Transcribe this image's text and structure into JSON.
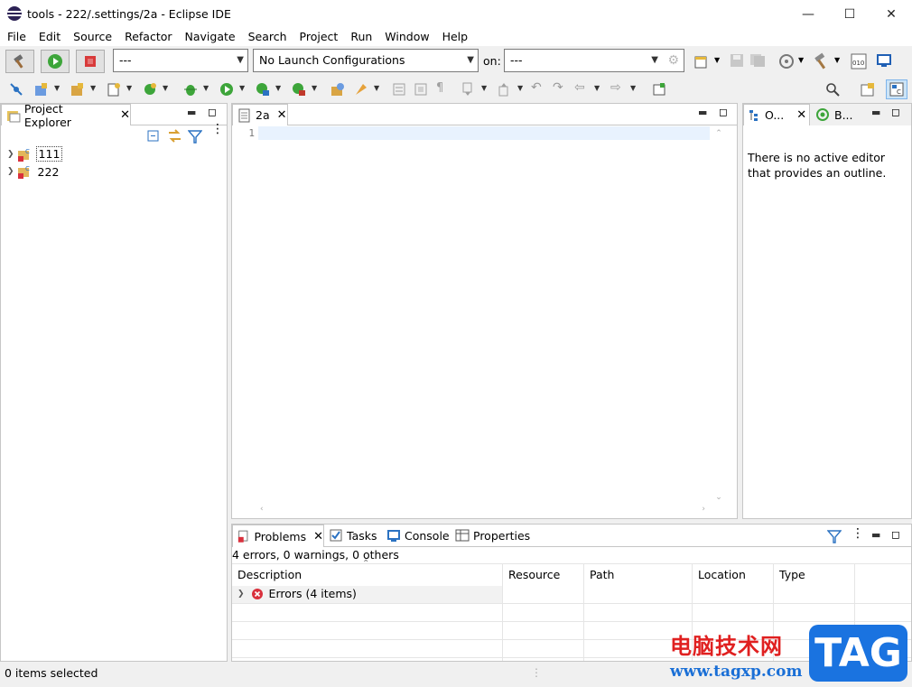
{
  "window": {
    "title": "tools - 222/.settings/2a - Eclipse IDE"
  },
  "menu": [
    "File",
    "Edit",
    "Source",
    "Refactor",
    "Navigate",
    "Search",
    "Project",
    "Run",
    "Window",
    "Help"
  ],
  "toolbar": {
    "run_combo_value": "---",
    "launch_config_value": "No Launch Configurations",
    "on_label": "on:",
    "target_combo_value": "---"
  },
  "project_explorer": {
    "tab_label": "Project Explorer",
    "projects": [
      "111",
      "222"
    ]
  },
  "editor": {
    "tab_label": "2a",
    "line_numbers": [
      "1"
    ]
  },
  "outline": {
    "tab1_label": "O...",
    "tab2_label": "B...",
    "message": "There is no active editor that provides an outline."
  },
  "problems": {
    "tabs": [
      "Problems",
      "Tasks",
      "Console",
      "Properties"
    ],
    "summary": "4 errors, 0 warnings, 0 others",
    "columns": [
      "Description",
      "Resource",
      "Path",
      "Location",
      "Type"
    ],
    "rows": [
      {
        "description": "Errors (4 items)"
      }
    ]
  },
  "status": {
    "left_text": "0 items selected"
  },
  "watermark": {
    "site_name": "电脑技术网",
    "url": "www.tagxp.com",
    "badge": "TAG"
  },
  "colors": {
    "accent": "#0078d7",
    "error": "#d9303c",
    "run_green": "#3da53a",
    "stop_red": "#d83a3a",
    "line_highlight": "#e8f2fe",
    "watermark_red": "#e02020",
    "watermark_blue": "#1a6fd6"
  }
}
